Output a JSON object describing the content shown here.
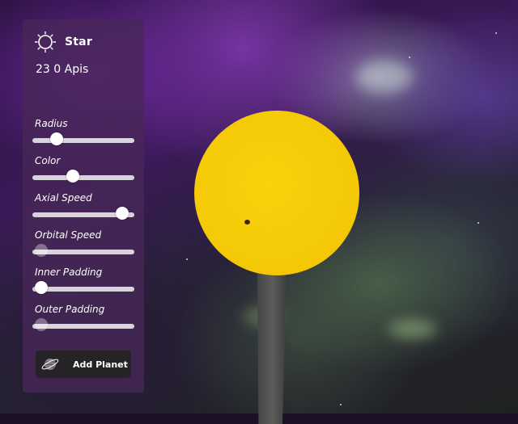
{
  "panel": {
    "title": "Star",
    "fps_text": "23 0 Apis",
    "controls": [
      {
        "label": "Radius",
        "value": 0.2,
        "disabled": false
      },
      {
        "label": "Color",
        "value": 0.38,
        "disabled": false
      },
      {
        "label": "Axial Speed",
        "value": 0.94,
        "disabled": false
      },
      {
        "label": "Orbital Speed",
        "value": 0.03,
        "disabled": true
      },
      {
        "label": "Inner Padding",
        "value": 0.03,
        "disabled": false
      },
      {
        "label": "Outer Padding",
        "value": 0.03,
        "disabled": true
      }
    ],
    "add_button_label": "Add Planet",
    "icons": {
      "title_icon": "sun-icon",
      "button_icon": "planet-icon"
    }
  },
  "colors": {
    "panel_bg": "#482858",
    "star": "#f4c806",
    "button_bg": "#262326",
    "slider_track": "#d9d4dc"
  }
}
